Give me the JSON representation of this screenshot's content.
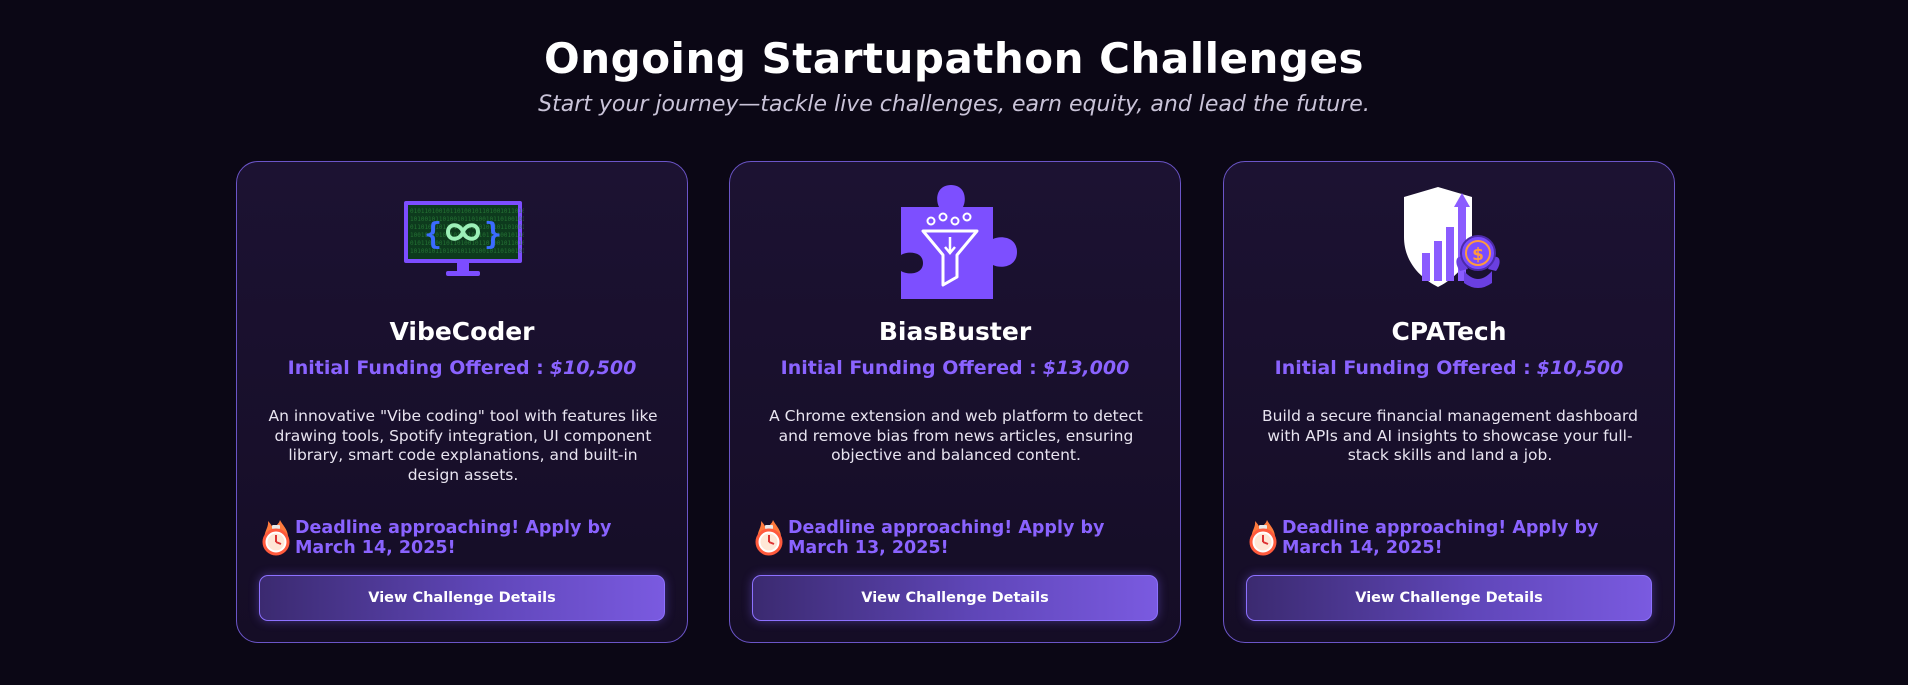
{
  "header": {
    "title": "Ongoing Startupathon Challenges",
    "subtitle": "Start your journey—tackle live challenges, earn equity, and lead the future."
  },
  "colors": {
    "background": "#0b0715",
    "accent": "#8a63ff",
    "card_border": "#6b55c8",
    "button_gradient_start": "#3b2a70",
    "button_gradient_end": "#7a5ae0"
  },
  "challenges": [
    {
      "icon": "monitor-infinity-code-icon",
      "title": "VibeCoder",
      "funding_label": "Initial Funding Offered :",
      "funding_amount": "$10,500",
      "description": "An innovative \"Vibe coding\" tool with features like drawing tools, Spotify integration, UI component library, smart code explanations, and built-in design assets.",
      "deadline_icon": "stopwatch-fire-icon",
      "deadline": "Deadline approaching! Apply by March 14, 2025!",
      "button_label": "View Challenge Details"
    },
    {
      "icon": "puzzle-funnel-icon",
      "title": "BiasBuster",
      "funding_label": "Initial Funding Offered :",
      "funding_amount": "$13,000",
      "description": "A Chrome extension and web platform to detect and remove bias from news articles, ensuring objective and balanced content.",
      "deadline_icon": "stopwatch-fire-icon",
      "deadline": "Deadline approaching! Apply by March 13, 2025!",
      "button_label": "View Challenge Details"
    },
    {
      "icon": "shield-growth-dollar-icon",
      "title": "CPATech",
      "funding_label": "Initial Funding Offered :",
      "funding_amount": "$10,500",
      "description": "Build a secure financial management dashboard with APIs and AI insights to showcase your full-stack skills and land a job.",
      "deadline_icon": "stopwatch-fire-icon",
      "deadline": "Deadline approaching! Apply by March 14, 2025!",
      "button_label": "View Challenge Details"
    }
  ]
}
